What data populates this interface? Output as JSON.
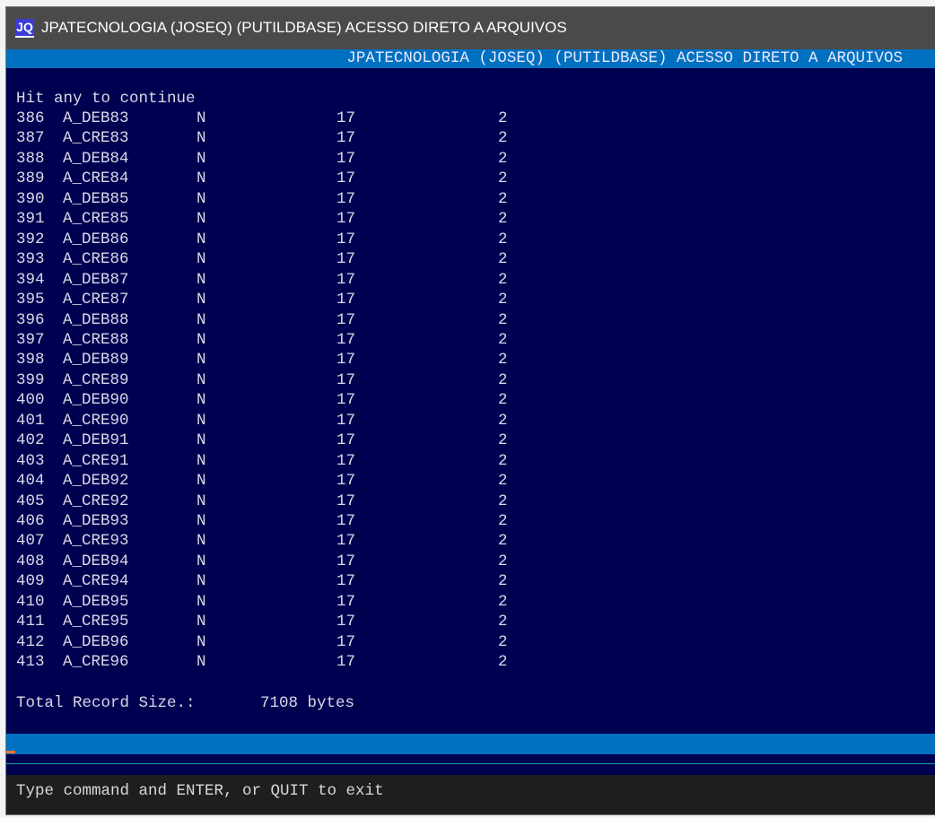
{
  "window": {
    "title": "JPATECNOLOGIA (JOSEQ) (PUTILDBASE) ACESSO DIRETO A ARQUIVOS",
    "logo": "JQ"
  },
  "header": "JPATECNOLOGIA (JOSEQ) (PUTILDBASE) ACESSO DIRETO A ARQUIVOS",
  "prompt": "Hit any to continue",
  "rows": [
    {
      "n": "386",
      "name": "A_DEB83",
      "type": "N",
      "len": "17",
      "dec": "2"
    },
    {
      "n": "387",
      "name": "A_CRE83",
      "type": "N",
      "len": "17",
      "dec": "2"
    },
    {
      "n": "388",
      "name": "A_DEB84",
      "type": "N",
      "len": "17",
      "dec": "2"
    },
    {
      "n": "389",
      "name": "A_CRE84",
      "type": "N",
      "len": "17",
      "dec": "2"
    },
    {
      "n": "390",
      "name": "A_DEB85",
      "type": "N",
      "len": "17",
      "dec": "2"
    },
    {
      "n": "391",
      "name": "A_CRE85",
      "type": "N",
      "len": "17",
      "dec": "2"
    },
    {
      "n": "392",
      "name": "A_DEB86",
      "type": "N",
      "len": "17",
      "dec": "2"
    },
    {
      "n": "393",
      "name": "A_CRE86",
      "type": "N",
      "len": "17",
      "dec": "2"
    },
    {
      "n": "394",
      "name": "A_DEB87",
      "type": "N",
      "len": "17",
      "dec": "2"
    },
    {
      "n": "395",
      "name": "A_CRE87",
      "type": "N",
      "len": "17",
      "dec": "2"
    },
    {
      "n": "396",
      "name": "A_DEB88",
      "type": "N",
      "len": "17",
      "dec": "2"
    },
    {
      "n": "397",
      "name": "A_CRE88",
      "type": "N",
      "len": "17",
      "dec": "2"
    },
    {
      "n": "398",
      "name": "A_DEB89",
      "type": "N",
      "len": "17",
      "dec": "2"
    },
    {
      "n": "399",
      "name": "A_CRE89",
      "type": "N",
      "len": "17",
      "dec": "2"
    },
    {
      "n": "400",
      "name": "A_DEB90",
      "type": "N",
      "len": "17",
      "dec": "2"
    },
    {
      "n": "401",
      "name": "A_CRE90",
      "type": "N",
      "len": "17",
      "dec": "2"
    },
    {
      "n": "402",
      "name": "A_DEB91",
      "type": "N",
      "len": "17",
      "dec": "2"
    },
    {
      "n": "403",
      "name": "A_CRE91",
      "type": "N",
      "len": "17",
      "dec": "2"
    },
    {
      "n": "404",
      "name": "A_DEB92",
      "type": "N",
      "len": "17",
      "dec": "2"
    },
    {
      "n": "405",
      "name": "A_CRE92",
      "type": "N",
      "len": "17",
      "dec": "2"
    },
    {
      "n": "406",
      "name": "A_DEB93",
      "type": "N",
      "len": "17",
      "dec": "2"
    },
    {
      "n": "407",
      "name": "A_CRE93",
      "type": "N",
      "len": "17",
      "dec": "2"
    },
    {
      "n": "408",
      "name": "A_DEB94",
      "type": "N",
      "len": "17",
      "dec": "2"
    },
    {
      "n": "409",
      "name": "A_CRE94",
      "type": "N",
      "len": "17",
      "dec": "2"
    },
    {
      "n": "410",
      "name": "A_DEB95",
      "type": "N",
      "len": "17",
      "dec": "2"
    },
    {
      "n": "411",
      "name": "A_CRE95",
      "type": "N",
      "len": "17",
      "dec": "2"
    },
    {
      "n": "412",
      "name": "A_DEB96",
      "type": "N",
      "len": "17",
      "dec": "2"
    },
    {
      "n": "413",
      "name": "A_CRE96",
      "type": "N",
      "len": "17",
      "dec": "2"
    }
  ],
  "total": {
    "label": "Total Record Size.:",
    "value": "7108 bytes"
  },
  "command_hint": "Type command and ENTER, or QUIT to exit"
}
